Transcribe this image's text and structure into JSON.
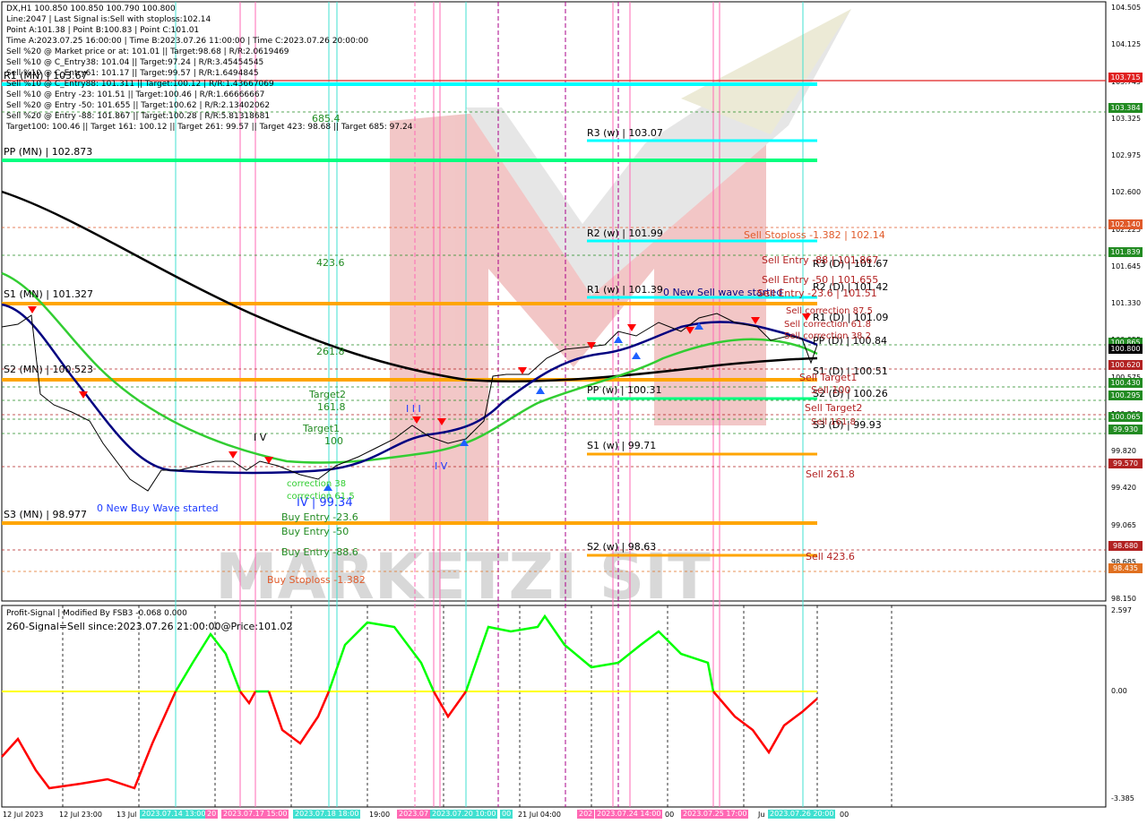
{
  "symbol_line": "DX,H1  100.850 100.850 100.790 100.800",
  "info_lines": [
    "Line:2047 | Last Signal is:Sell with stoploss:102.14",
    "Point A:101.38 | Point B:100.83 | Point C:101.01",
    "Time A:2023.07.25 16:00:00 | Time B:2023.07.26 11:00:00 | Time C:2023.07.26 20:00:00",
    "Sell %20 @ Market price or at: 101.01 || Target:98.68 | R/R:2.0619469",
    "Sell %10 @ C_Entry38: 101.04 || Target:97.24 | R/R:3.45454545",
    "Sell %10 @ C_Entry61: 101.17 || Target:99.57 | R/R:1.6494845",
    "Sell %10 @ C_Entry88: 101.311 || Target:100.12 | R/R:1.43667069",
    "Sell %10 @ Entry -23: 101.51 || Target:100.46 | R/R:1.66666667",
    "Sell %20 @ Entry -50: 101.655 || Target:100.62 | R/R:2.13402062",
    "Sell %20 @ Entry -88: 101.867 || Target:100.28 | R/R:5.81318681",
    "Target100: 100.46 || Target 161: 100.12 || Target 261: 99.57 || Target 423: 98.68 || Target 685: 97.24"
  ],
  "levels": {
    "r1_mn": "R1 (MN) | 103.67",
    "pp_mn": "PP (MN) | 102.873",
    "s1_mn": "S1 (MN) | 101.327",
    "s2_mn": "S2 (MN) | 100.523",
    "s3_mn": "S3 (MN) | 98.977",
    "r3_w": "R3 (w) | 103.07",
    "r2_w": "R2 (w) | 101.99",
    "r1_w": "R1 (w) | 101.39",
    "pp_w": "PP (w) | 100.31",
    "s1_w": "S1 (w) | 99.71",
    "s2_w": "S2 (w) | 98.63",
    "r3_d": "R3 (D) | 101.67",
    "r2_d": "R2 (D) | 101.42",
    "r1_d": "R1 (D) | 101.09",
    "pp_d": "PP (D) | 100.84",
    "s1_d": "S1 (D) | 100.51",
    "s2_d": "S2 (D) | 100.26",
    "s3_d": "S3 (D) | 99.93"
  },
  "annotations": {
    "fib_685": "685.4",
    "fib_423": "423.6",
    "fib_261": "261.8",
    "fib_161": "161.8",
    "fib_100": "100",
    "target2": "Target2",
    "target1": "Target1",
    "new_buy_wave": "0 New Buy Wave started",
    "new_sell_wave": "0 New Sell wave started",
    "wave_label": "IV | 99.34",
    "wave_iv_a": "I V",
    "wave_iv_b": "I V",
    "wave_iii": "I I I",
    "correction_a": "correction 38",
    "correction_b": "correction 61.5",
    "buy_entry_23": "Buy Entry -23.6",
    "buy_entry_50": "Buy Entry -50",
    "buy_entry_88": "Buy Entry -88.6",
    "buy_stoploss": "Buy Stoploss -1.382",
    "sell_stoploss": "Sell Stoploss -1.382 | 102.14",
    "sell_entry_88": "Sell Entry -88 | 101.867",
    "sell_entry_50": "Sell Entry -50 | 101.655",
    "sell_entry_23": "Sell Entry -23.6 | 101.51",
    "sell_corr_87": "Sell correction 87.5",
    "sell_corr_61": "Sell correction 61.8",
    "sell_corr_38": "Sell correction 38.2",
    "sell_target1": "Sell Target1",
    "sell_100": "Sell 100",
    "sell_target2": "Sell Target2",
    "sell_161": "Sell 161.8",
    "sell_261": "Sell 261.8",
    "sell_423": "Sell 423.6"
  },
  "price_scale": [
    "104.505",
    "104.125",
    "103.745",
    "103.325",
    "102.975",
    "102.600",
    "102.225",
    "101.645",
    "101.330",
    "100.955",
    "100.575",
    "100.200",
    "99.820",
    "99.420",
    "99.065",
    "98.685",
    "98.150"
  ],
  "price_tags": [
    {
      "value": "103.715",
      "color": "#e02020"
    },
    {
      "value": "103.384",
      "color": "#228b22"
    },
    {
      "value": "102.140",
      "color": "#e05a2a"
    },
    {
      "value": "101.839",
      "color": "#228b22"
    },
    {
      "value": "100.865",
      "color": "#228b22"
    },
    {
      "value": "100.800",
      "color": "#000000"
    },
    {
      "value": "100.620",
      "color": "#b22222"
    },
    {
      "value": "100.430",
      "color": "#228b22"
    },
    {
      "value": "100.295",
      "color": "#228b22"
    },
    {
      "value": "100.065",
      "color": "#228b22"
    },
    {
      "value": "99.930",
      "color": "#228b22"
    },
    {
      "value": "99.570",
      "color": "#b22222"
    },
    {
      "value": "98.680",
      "color": "#b22222"
    },
    {
      "value": "98.435",
      "color": "#e07020"
    }
  ],
  "indicator": {
    "title": "Profit-Signal | Modified By FSB3 -0.068 0.000",
    "signal": "260-Signal=Sell since:2023.07.26 21:00:00@Price:101.02",
    "scale_top": "2.597",
    "scale_mid": "0.00",
    "scale_bottom": "-3.385"
  },
  "time_labels": [
    "12 Jul 2023",
    "12 Jul 23:00",
    "13 Jul",
    "19:00",
    "21 Jul 04:00",
    "00",
    "Ju",
    "00"
  ],
  "time_tags": [
    {
      "text": "2023.07.14 13:00",
      "color": "#40e0d0"
    },
    {
      "text": "20",
      "color": "#ff69b4"
    },
    {
      "text": "2023.07.17 15:00",
      "color": "#ff69b4"
    },
    {
      "text": "2023.07.18 18:00",
      "color": "#40e0d0"
    },
    {
      "text": "2023.07",
      "color": "#ff69b4"
    },
    {
      "text": "2023.07.20 10:00",
      "color": "#40e0d0"
    },
    {
      "text": "00",
      "color": "#40e0d0"
    },
    {
      "text": "202",
      "color": "#ff69b4"
    },
    {
      "text": "2023.07.24 14:00",
      "color": "#ff69b4"
    },
    {
      "text": "2023.07.25 17:00",
      "color": "#ff69b4"
    },
    {
      "text": "2023.07.26 20:00",
      "color": "#40e0d0"
    }
  ],
  "colors": {
    "cyan": "#00ffff",
    "green": "#00ff7f",
    "orange": "#ffa500",
    "red": "#ff0000",
    "navy": "#000080",
    "ma_green": "#32cd32",
    "black_ma": "#000000",
    "magenta": "#ff00ff",
    "yellow": "#ffff00"
  }
}
